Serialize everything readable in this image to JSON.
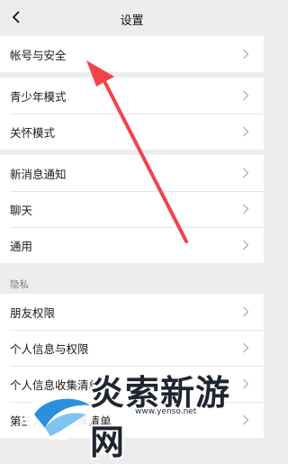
{
  "header": {
    "title": "设置",
    "back_icon": "chevron-left-icon"
  },
  "groups": [
    {
      "items": [
        {
          "label": "帐号与安全"
        }
      ]
    },
    {
      "items": [
        {
          "label": "青少年模式"
        },
        {
          "label": "关怀模式"
        }
      ]
    },
    {
      "items": [
        {
          "label": "新消息通知"
        },
        {
          "label": "聊天"
        },
        {
          "label": "通用"
        }
      ]
    }
  ],
  "privacy": {
    "section_label": "隐私",
    "items": [
      {
        "label": "朋友权限"
      },
      {
        "label": "个人信息与权限"
      },
      {
        "label": "个人信息收集清单"
      },
      {
        "label": "第三方信息共享清单"
      }
    ]
  },
  "watermark": {
    "text": "炎索新游网",
    "url": "www.yenso.net"
  },
  "colors": {
    "background": "#ededed",
    "row": "#ffffff",
    "arrow": "#f2434b",
    "chevron": "#b2b2b2"
  }
}
